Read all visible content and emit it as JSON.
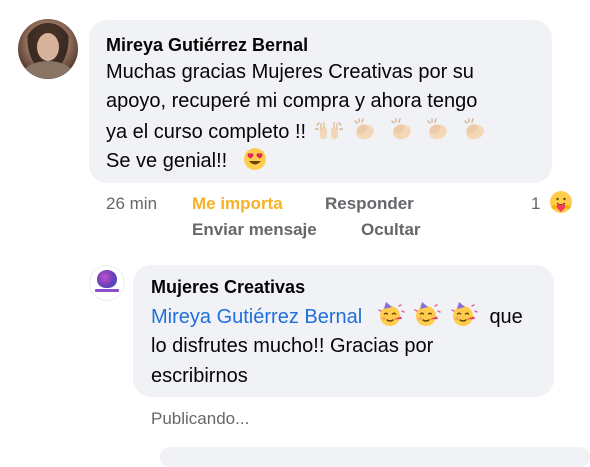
{
  "comment": {
    "author": "Mireya Gutiérrez Bernal",
    "lines": [
      "Muchas gracias Mujeres Creativas por su",
      "apoyo, recuperé mi compra y ahora tengo",
      "ya el curso completo !!",
      "Se ve genial!!"
    ],
    "time": "26 min",
    "like_label": "Me importa",
    "reply_label": "Responder",
    "message_label": "Enviar mensaje",
    "hide_label": "Ocultar",
    "reaction_count": "1",
    "reaction_icon": "care-reaction-icon"
  },
  "reply": {
    "author": "Mujeres Creativas",
    "mention": "Mireya Gutiérrez Bernal",
    "line1_suffix": "que",
    "line2": "lo disfrutes mucho!! Gracias por",
    "line3": "escribirnos",
    "status": "Publicando..."
  },
  "icons": {
    "celebration_emojis": [
      "raising-hands-icon",
      "clapping-hands-icon",
      "clapping-hands-icon",
      "clapping-hands-icon",
      "clapping-hands-icon"
    ],
    "heart_eyes_emoji": "heart-eyes-icon",
    "party_emojis": [
      "partying-face-icon",
      "partying-face-icon",
      "partying-face-icon"
    ]
  },
  "colors": {
    "bubble": "#f0f2f5",
    "mention": "#216fdb",
    "like_active": "#f7b125",
    "secondary_text": "#65676b"
  }
}
